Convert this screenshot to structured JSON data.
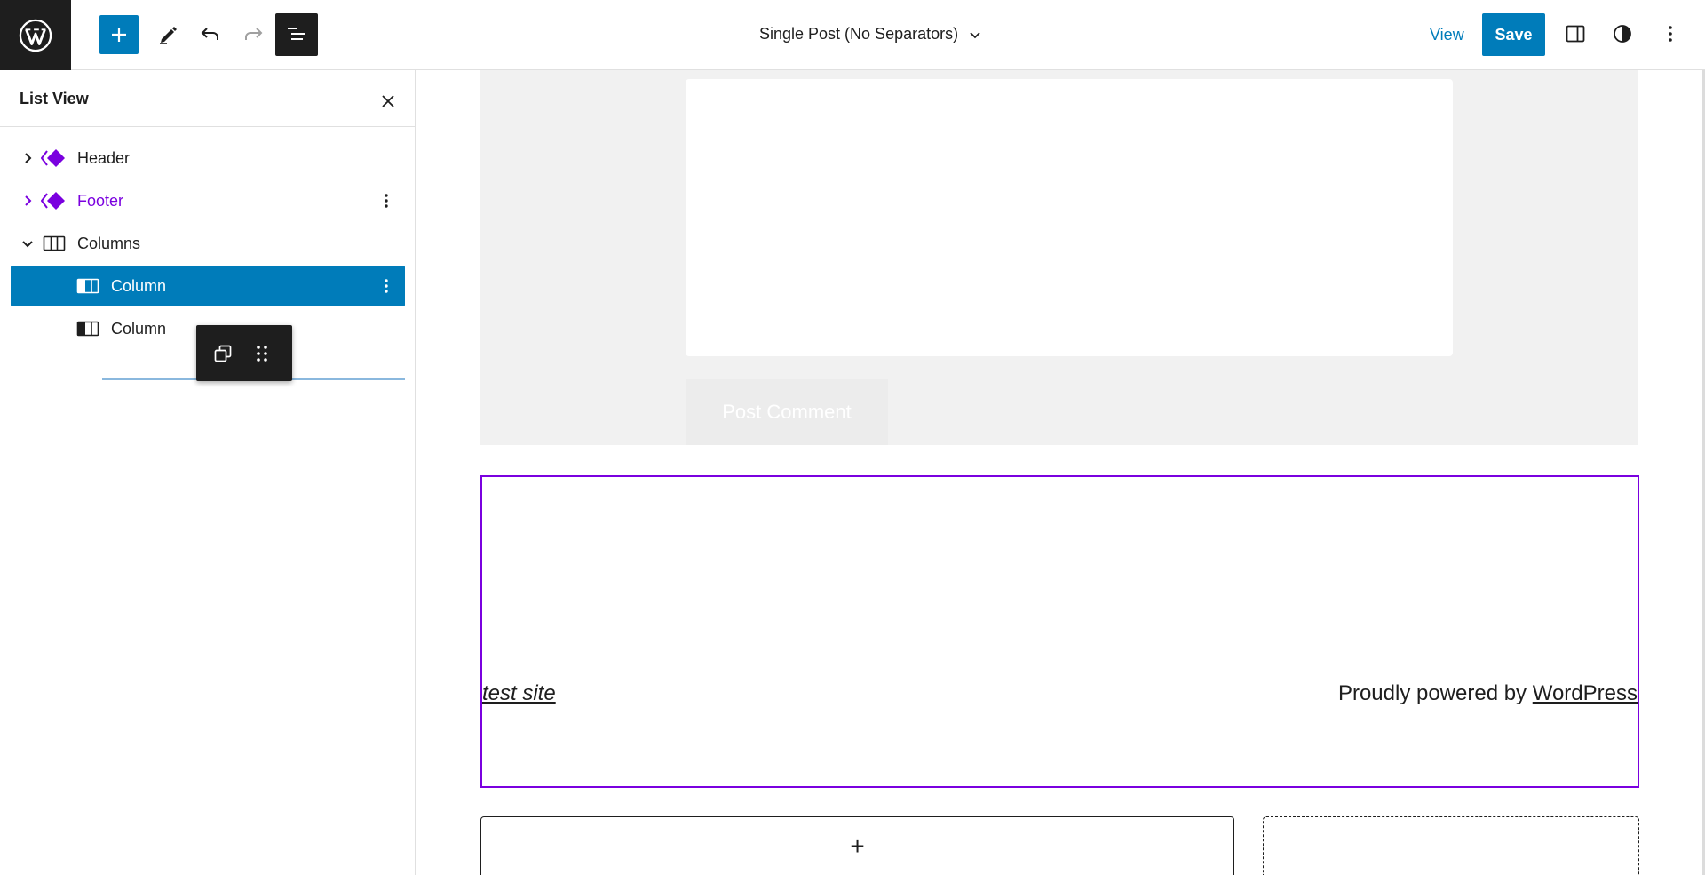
{
  "toolbar": {
    "document_title": "Single Post (No Separators)",
    "view_label": "View",
    "save_label": "Save",
    "icons": {
      "logo": "wordpress-logo-icon",
      "inserter": "plus-icon",
      "tools": "pencil-icon",
      "undo": "undo-icon",
      "redo": "redo-icon",
      "list_view": "list-view-icon",
      "title_dropdown": "chevron-down-icon",
      "settings": "sidebar-toggle-icon",
      "styles": "half-circle-contrast-icon",
      "options": "vertical-ellipsis-icon"
    }
  },
  "list_view": {
    "title": "List View",
    "items": [
      {
        "label": "Header",
        "icon": "template-part-icon",
        "expanded": false,
        "level": 1
      },
      {
        "label": "Footer",
        "icon": "template-part-icon",
        "expanded": false,
        "level": 1
      },
      {
        "label": "Columns",
        "icon": "columns-icon",
        "expanded": true,
        "level": 1
      },
      {
        "label": "Column",
        "icon": "column-icon",
        "selected": true,
        "level": 2
      },
      {
        "label": "Column",
        "icon": "column-icon",
        "level": 2
      }
    ]
  },
  "block_toolbar": {
    "icons": [
      "duplicate-icon",
      "drag-handle-icon"
    ]
  },
  "canvas": {
    "post_comment_label": "Post Comment",
    "footer_site_title": "test site",
    "footer_powered_prefix": "Proudly powered by ",
    "footer_powered_link": "WordPress",
    "appender_label": "+"
  },
  "colors": {
    "accent": "#007cba",
    "dark": "#1e1e1e",
    "template_part": "#7a00df",
    "comment_bg": "#f1f1f1"
  }
}
